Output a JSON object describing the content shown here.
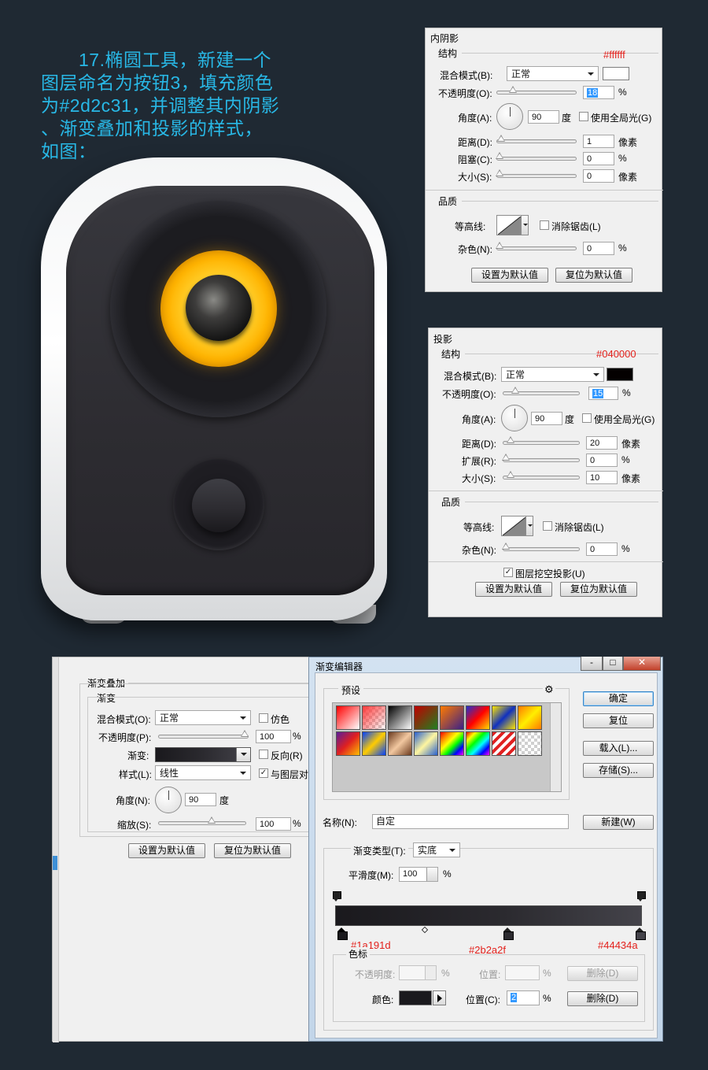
{
  "instruction": {
    "lines": [
      "17.椭圆工具，新建一个",
      "图层命名为按钮3，填充颜色",
      "为#2d2c31，并调整其内阴影",
      "、渐变叠加和投影的样式，",
      "如图："
    ]
  },
  "speaker": {
    "face_color": "#2d2c31",
    "woofer_color": "#ffb300"
  },
  "inner_shadow": {
    "title": "内阴影",
    "structure_label": "结构",
    "color_note": "#ffffff",
    "blend_label": "混合模式(B):",
    "blend_value": "正常",
    "swatch_color": "#ffffff",
    "opacity_label": "不透明度(O):",
    "opacity_value": "18",
    "angle_label": "角度(A):",
    "angle_value": "90",
    "degree_unit": "度",
    "global_light_label": "使用全局光(G)",
    "distance_label": "距离(D):",
    "distance_value": "1",
    "choke_label": "阻塞(C):",
    "choke_value": "0",
    "size_label": "大小(S):",
    "size_value": "0",
    "quality_label": "品质",
    "contour_label": "等高线:",
    "antialias_label": "消除锯齿(L)",
    "noise_label": "杂色(N):",
    "noise_value": "0",
    "pct": "%",
    "px_unit": "像素",
    "make_default": "设置为默认值",
    "reset_default": "复位为默认值"
  },
  "drop_shadow": {
    "title": "投影",
    "structure_label": "结构",
    "color_note": "#040000",
    "blend_label": "混合模式(B):",
    "blend_value": "正常",
    "swatch_color": "#040000",
    "opacity_label": "不透明度(O):",
    "opacity_value": "15",
    "angle_label": "角度(A):",
    "angle_value": "90",
    "degree_unit": "度",
    "global_light_label": "使用全局光(G)",
    "distance_label": "距离(D):",
    "distance_value": "20",
    "spread_label": "扩展(R):",
    "spread_value": "0",
    "size_label": "大小(S):",
    "size_value": "10",
    "quality_label": "品质",
    "contour_label": "等高线:",
    "antialias_label": "消除锯齿(L)",
    "noise_label": "杂色(N):",
    "noise_value": "0",
    "knockout_label": "图层挖空投影(U)",
    "pct": "%",
    "px_unit": "像素",
    "make_default": "设置为默认值",
    "reset_default": "复位为默认值"
  },
  "gradient_overlay": {
    "title": "渐变叠加",
    "section": "渐变",
    "blend_label": "混合模式(O):",
    "blend_value": "正常",
    "dither_label": "仿色",
    "opacity_label": "不透明度(P):",
    "opacity_value": "100",
    "gradient_label": "渐变:",
    "reverse_label": "反向(R)",
    "style_label": "样式(L):",
    "style_value": "线性",
    "align_label": "与图层对",
    "angle_label": "角度(N):",
    "angle_value": "90",
    "degree_unit": "度",
    "scale_label": "缩放(S):",
    "scale_value": "100",
    "pct": "%",
    "make_default": "设置为默认值",
    "reset_default": "复位为默认值"
  },
  "gradient_editor": {
    "title": "渐变编辑器",
    "presets_label": "预设",
    "gear_icon": "⚙",
    "ok": "确定",
    "reset": "复位",
    "load": "载入(L)...",
    "save": "存储(S)...",
    "name_label": "名称(N):",
    "name_value": "自定",
    "new_button": "新建(W)",
    "type_label": "渐变类型(T):",
    "type_value": "实底",
    "smooth_label": "平滑度(M):",
    "smooth_value": "100",
    "pct": "%",
    "stop_colors": [
      "#1a191d",
      "#2b2a2f",
      "#44434a"
    ],
    "stops_section": "色标",
    "opacity_label": "不透明度:",
    "position_label": "位置:",
    "delete_label": "删除(D)",
    "color_label": "颜色:",
    "color_position_label": "位置(C):",
    "color_position_value": "2",
    "minimize": "-",
    "maximize": "□",
    "close": "✕"
  }
}
